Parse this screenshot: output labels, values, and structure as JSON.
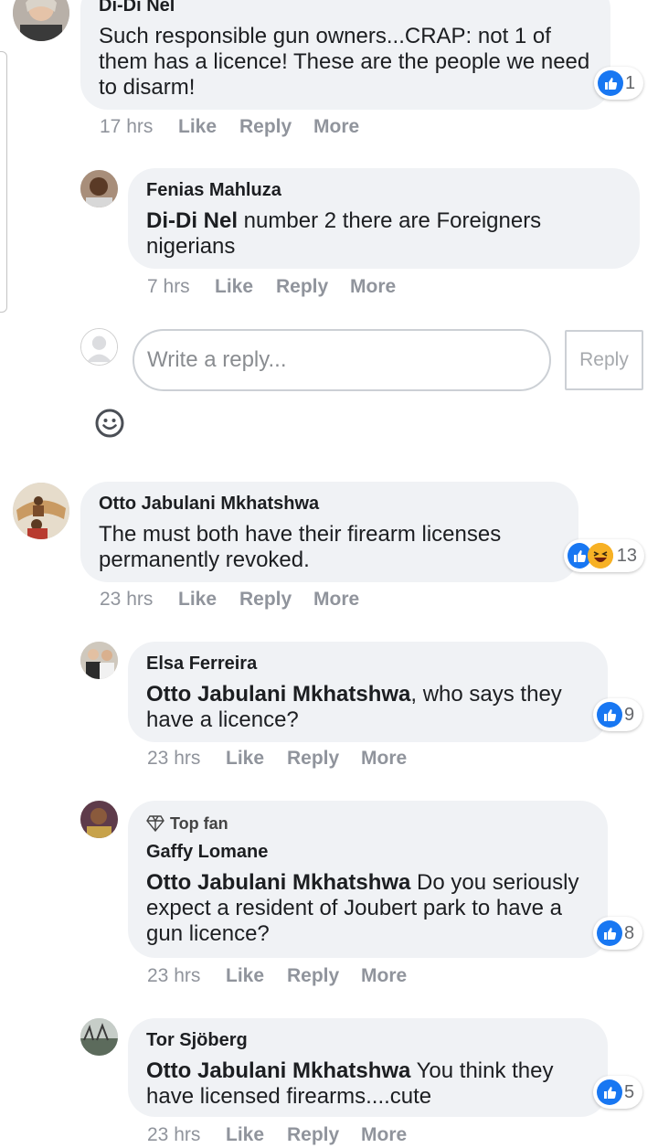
{
  "comments": [
    {
      "author": "Di-Di Nel",
      "mention": "",
      "text": "Such responsible gun owners...CRAP: not 1 of them has a licence! These are the people we need to disarm!",
      "time": "17 hrs",
      "reactions": "1",
      "replies": [
        {
          "author": "Fenias Mahluza",
          "mention": "Di-Di Nel",
          "text": " number 2 there are Foreigners nigerians",
          "time": "7 hrs",
          "reactions": ""
        }
      ]
    },
    {
      "author": "Otto Jabulani Mkhatshwa",
      "mention": "",
      "text": "The must both have their firearm licenses permanently revoked.",
      "time": "23 hrs",
      "reactions": "13",
      "replies": [
        {
          "author": "Elsa Ferreira",
          "mention": "Otto Jabulani Mkhatshwa",
          "text": ", who says they have a licence?",
          "time": "23 hrs",
          "reactions": "9"
        },
        {
          "badge": "Top fan",
          "author": "Gaffy Lomane",
          "mention": "Otto Jabulani Mkhatshwa",
          "text": " Do you seriously expect a resident of Joubert park to have a gun licence?",
          "time": "23 hrs",
          "reactions": "8"
        },
        {
          "author": "Tor Sjöberg",
          "mention": "Otto Jabulani Mkhatshwa",
          "text": " You think they have licensed firearms....cute",
          "time": "23 hrs",
          "reactions": "5"
        }
      ]
    }
  ],
  "actions": {
    "like": "Like",
    "reply": "Reply",
    "more": "More"
  },
  "composer": {
    "placeholder": "Write a reply...",
    "submit": "Reply",
    "emoji_icon": "smiley-icon"
  },
  "colors": {
    "like_blue": "#1877f2",
    "bubble": "#f0f2f5",
    "muted": "#90949c"
  }
}
